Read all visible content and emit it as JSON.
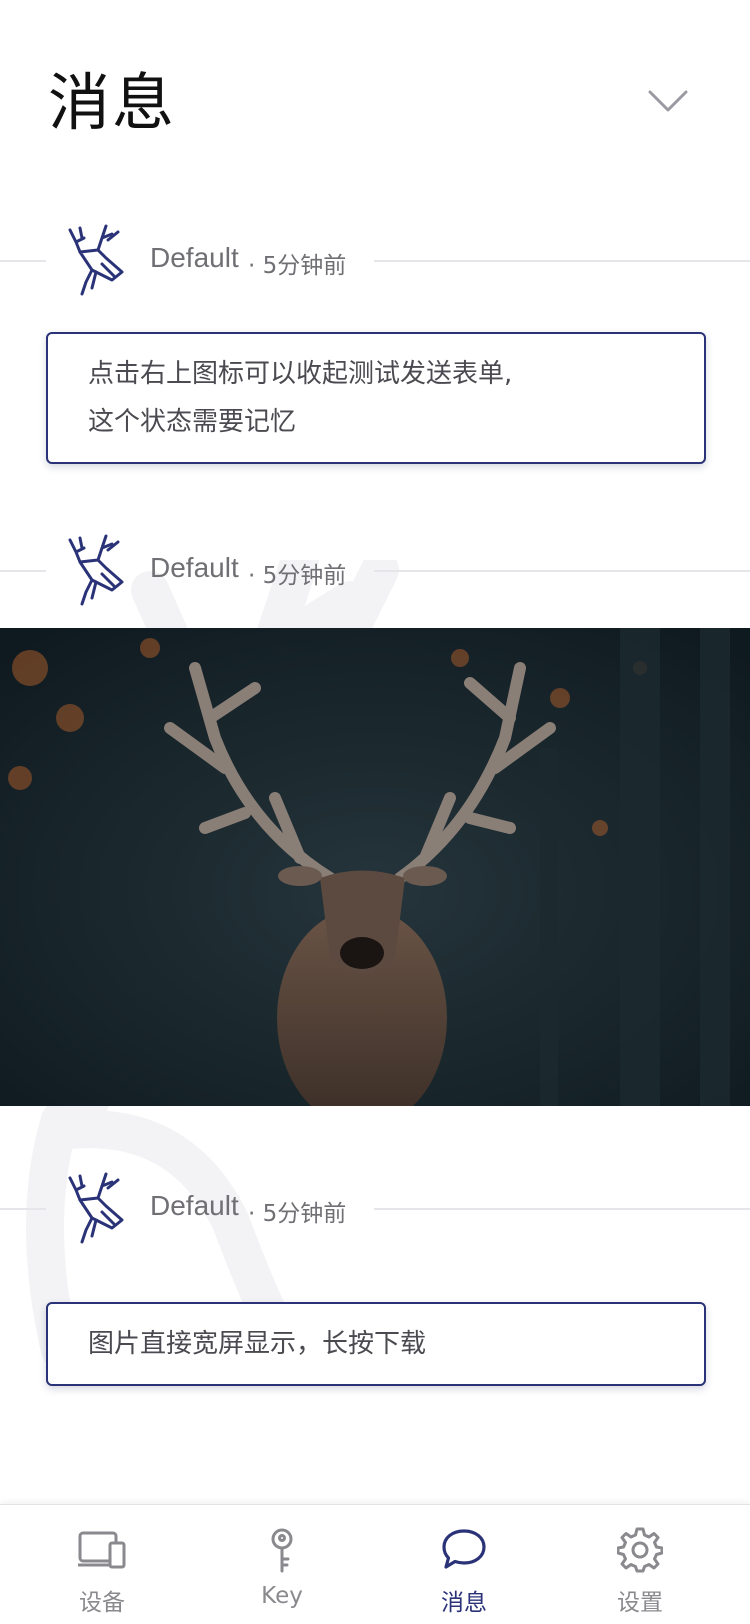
{
  "header": {
    "title": "消息",
    "collapse_icon": "chevron-down-icon"
  },
  "messages": [
    {
      "sender": "Default",
      "time": "· 5分钟前",
      "type": "text",
      "lines": [
        "点击右上图标可以收起测试发送表单,",
        "这个状态需要记忆"
      ]
    },
    {
      "sender": "Default",
      "time": "· 5分钟前",
      "type": "image",
      "image_subject": "deer-photo"
    },
    {
      "sender": "Default",
      "time": "· 5分钟前",
      "type": "text",
      "lines": [
        "图片直接宽屏显示，长按下载"
      ]
    }
  ],
  "tabbar": {
    "items": [
      {
        "label": "设备",
        "icon": "device-icon",
        "active": false
      },
      {
        "label": "Key",
        "icon": "key-icon",
        "active": false
      },
      {
        "label": "消息",
        "icon": "chat-bubble-icon",
        "active": true
      },
      {
        "label": "设置",
        "icon": "gear-icon",
        "active": false
      }
    ]
  },
  "colors": {
    "accent": "#2b3378",
    "text_primary": "#111111",
    "text_secondary": "#6f6f74",
    "divider": "#e6e6ea"
  }
}
